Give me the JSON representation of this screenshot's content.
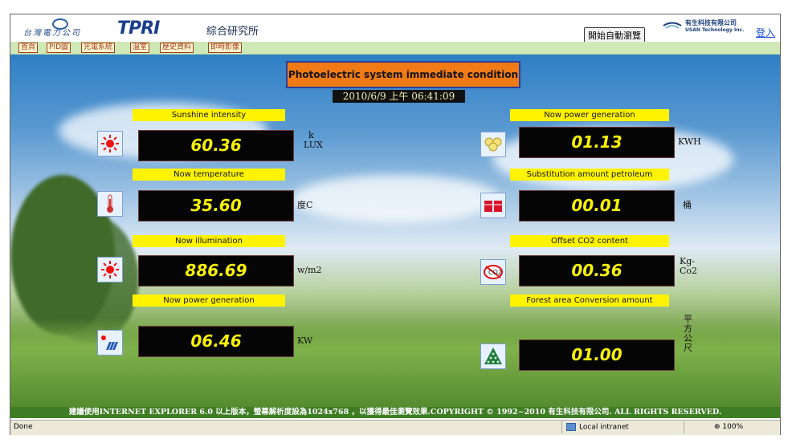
{
  "header": {
    "company_name": "台灣電力公司",
    "logo_text": "TPRI",
    "institute_name": "綜合研究所",
    "auto_browse_button": "開始自動瀏覽",
    "vendor_name": "有生科技有限公司",
    "vendor_name_en": "USAN Technology Inc.",
    "login_link": "登入"
  },
  "nav": {
    "items": [
      {
        "label": "首頁"
      },
      {
        "label": "PID圖"
      },
      {
        "label": "光電系統"
      },
      {
        "label": "溫室"
      },
      {
        "label": "歷史資料"
      },
      {
        "label": "即時影像"
      }
    ]
  },
  "panel": {
    "title": "Photoelectric system immediate condition",
    "datetime": "2010/6/9 上午 06:41:09"
  },
  "left_metrics": [
    {
      "label": "Sunshine intensity",
      "value": "60.36",
      "unit_line1": "k",
      "unit_line2": "LUX",
      "icon": "sun-icon"
    },
    {
      "label": "Now temperature",
      "value": "35.60",
      "unit_line1": "度C",
      "unit_line2": "",
      "icon": "thermometer-icon"
    },
    {
      "label": "Now illumination",
      "value": "886.69",
      "unit_line1": "w/m2",
      "unit_line2": "",
      "icon": "sun-icon"
    },
    {
      "label": "Now power generation",
      "value": "06.46",
      "unit_line1": "KW",
      "unit_line2": "",
      "icon": "solar-panel-icon"
    }
  ],
  "right_metrics": [
    {
      "label": "Now power generation",
      "value": "01.13",
      "unit_line1": "KWH",
      "unit_line2": "",
      "icon": "light-bulbs-icon"
    },
    {
      "label": "Substitution amount petroleum",
      "value": "00.01",
      "unit_line1": "桶",
      "unit_line2": "",
      "icon": "oil-barrel-icon"
    },
    {
      "label": "Offset CO2 content",
      "value": "00.36",
      "unit_line1": "Kg-",
      "unit_line2": "Co2",
      "icon": "co2-icon"
    },
    {
      "label": "Forest  area Conversion amount",
      "value": "01.00",
      "unit_line1": "平方公尺",
      "unit_line2": "",
      "icon": "tree-icon"
    }
  ],
  "footer": {
    "text": "建議使用INTERNET EXPLORER 6.0 以上版本，螢幕解析度設為1024x768 ，以獲得最佳瀏覽效果.COPYRIGHT © 1992~2010 有生科技有限公司. ALL RIGHTS RESERVED."
  },
  "statusbar": {
    "status": "Done",
    "zone": "Local intranet",
    "zoom": "100%"
  },
  "colors": {
    "label_bg": "#fff300",
    "value_text": "#f8f20a",
    "title_bg": "#f07b16",
    "nav_bg": "#cfe9b6",
    "footer_bg": "#3f7d25"
  }
}
